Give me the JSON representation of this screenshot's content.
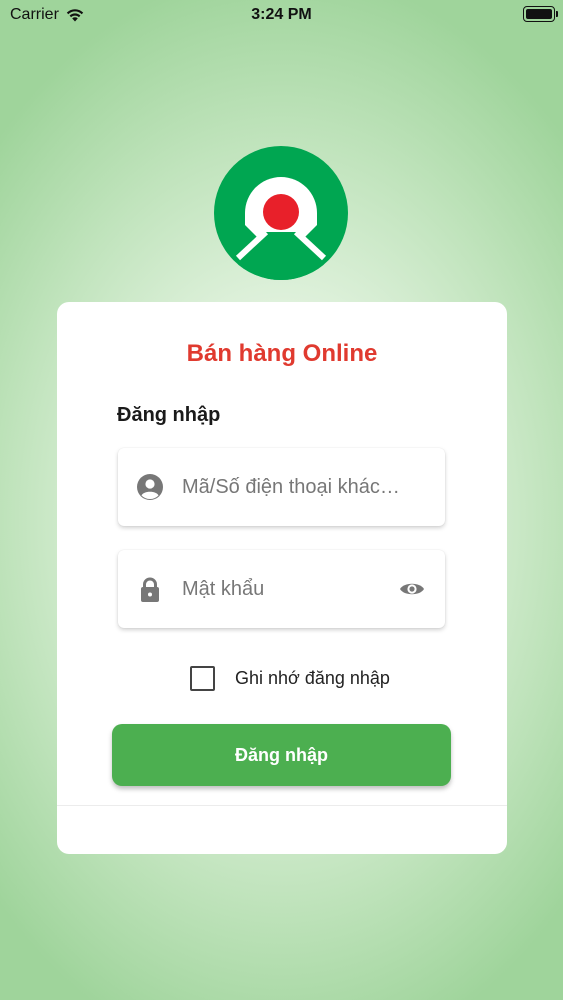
{
  "status_bar": {
    "carrier": "Carrier",
    "time": "3:24 PM"
  },
  "login": {
    "title": "Bán hàng Online",
    "section_label": "Đăng nhập",
    "username_placeholder": "Mã/Số điện thoại khác…",
    "password_placeholder": "Mật khẩu",
    "remember_label": "Ghi nhớ đăng nhập",
    "remember_checked": false,
    "submit_label": "Đăng nhập"
  },
  "icons": {
    "logo": "app-logo",
    "user": "user-icon",
    "lock": "lock-icon",
    "eye": "eye-icon",
    "wifi": "wifi-icon",
    "battery": "battery-icon"
  },
  "colors": {
    "brand_green": "#00a651",
    "brand_red": "#e8202a",
    "title_red": "#e03a2f",
    "button_green": "#4caf50"
  }
}
